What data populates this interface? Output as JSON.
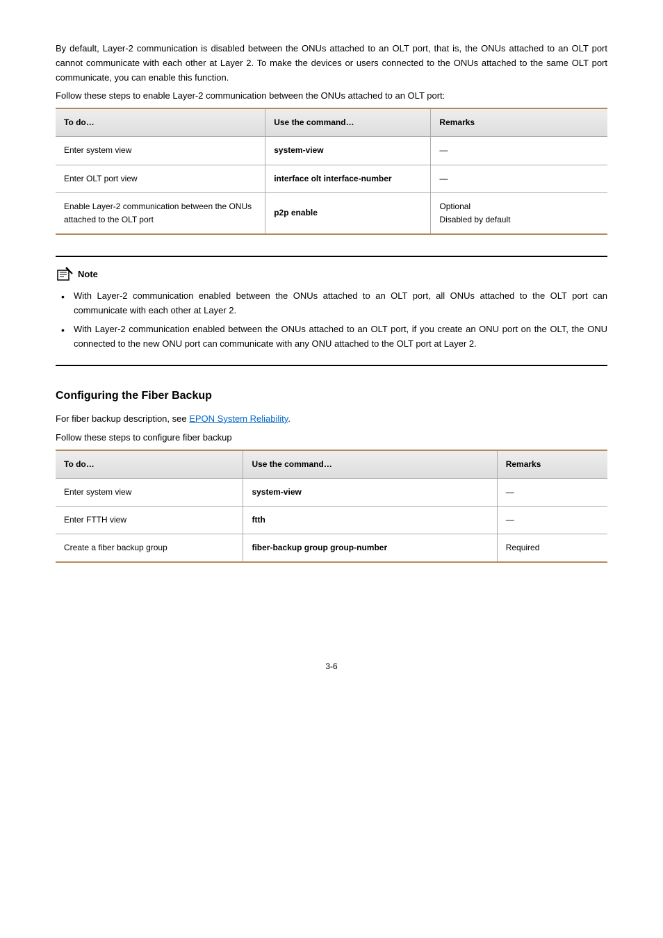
{
  "intro": {
    "p1": "By default, Layer-2 communication is disabled between the ONUs attached to an OLT port, that is, the ONUs attached to an OLT port cannot communicate with each other at Layer 2. To make the devices or users connected to the ONUs attached to the same OLT port communicate, you can enable this function.",
    "p2": "Follow these steps to enable Layer-2 communication between the ONUs attached to an OLT port:"
  },
  "table1": {
    "headers": {
      "c1": "To do…",
      "c2": "Use the command…",
      "c3": "Remarks"
    },
    "rows": [
      {
        "c1": "Enter system view",
        "c2": "system-view",
        "c3": "—"
      },
      {
        "c1": "Enter OLT port view",
        "c2": "interface olt interface-number",
        "c3": "—"
      },
      {
        "c1": "Enable Layer-2 communication between the ONUs attached to the OLT port",
        "c2": "p2p enable",
        "c3a": "Optional",
        "c3b": "Disabled by default"
      }
    ]
  },
  "note": {
    "label": "Note",
    "items": [
      "With Layer-2 communication enabled between the ONUs attached to an OLT port, all ONUs attached to the OLT port can communicate with each other at Layer 2.",
      "With Layer-2 communication enabled between the ONUs attached to an OLT port, if you create an ONU port on the OLT, the ONU connected to the new ONU port can communicate with any ONU attached to the OLT port at Layer 2."
    ]
  },
  "fiber": {
    "title": "Configuring the Fiber Backup",
    "desc_pre": " For fiber backup description, see ",
    "desc_link": "EPON System Reliability",
    "desc_post": ".",
    "steps": "Follow these steps to configure fiber backup"
  },
  "table2": {
    "headers": {
      "c1": "To do…",
      "c2": "Use the command…",
      "c3": "Remarks"
    },
    "rows": [
      {
        "c1": "Enter system view",
        "c2": "system-view",
        "c3": "—"
      },
      {
        "c1": "Enter FTTH view",
        "c2": "ftth",
        "c3": "—"
      },
      {
        "c1": "Create a fiber backup group",
        "c2": "fiber-backup group group-number",
        "c3": "Required"
      }
    ]
  },
  "page": "3-6"
}
